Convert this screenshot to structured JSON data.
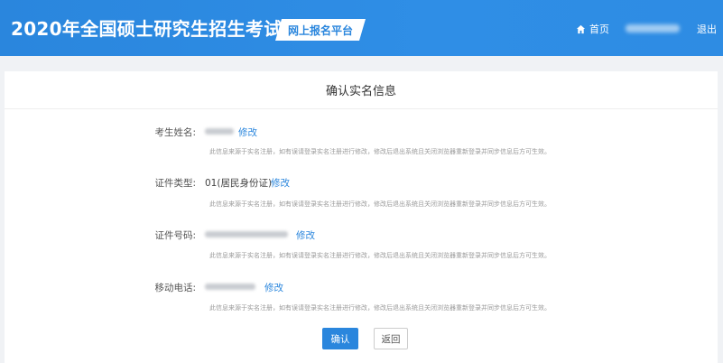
{
  "header": {
    "site_title": "2020年全国硕士研究生招生考试",
    "platform_tag": "网上报名平台",
    "home_label": "首页",
    "logout_label": "退出"
  },
  "card": {
    "title": "确认实名信息",
    "note": "此信息来源于实名注册，如有误请登录实名注册进行修改，修改后退出系统且关闭浏览器重新登录并同步信息后方可生效。",
    "fields": [
      {
        "label": "考生姓名:",
        "value": "",
        "edit_label": "修改"
      },
      {
        "label": "证件类型:",
        "value": "01(居民身份证)",
        "edit_label": "修改"
      },
      {
        "label": "证件号码:",
        "value": "",
        "edit_label": "修改"
      },
      {
        "label": "移动电话:",
        "value": "",
        "edit_label": "修改"
      }
    ],
    "confirm_label": "确认",
    "back_label": "返回"
  },
  "colors": {
    "brand": "#2a86dd",
    "note": "#999999",
    "background": "#f0f2f5"
  },
  "icons": {
    "home": "home-icon"
  }
}
